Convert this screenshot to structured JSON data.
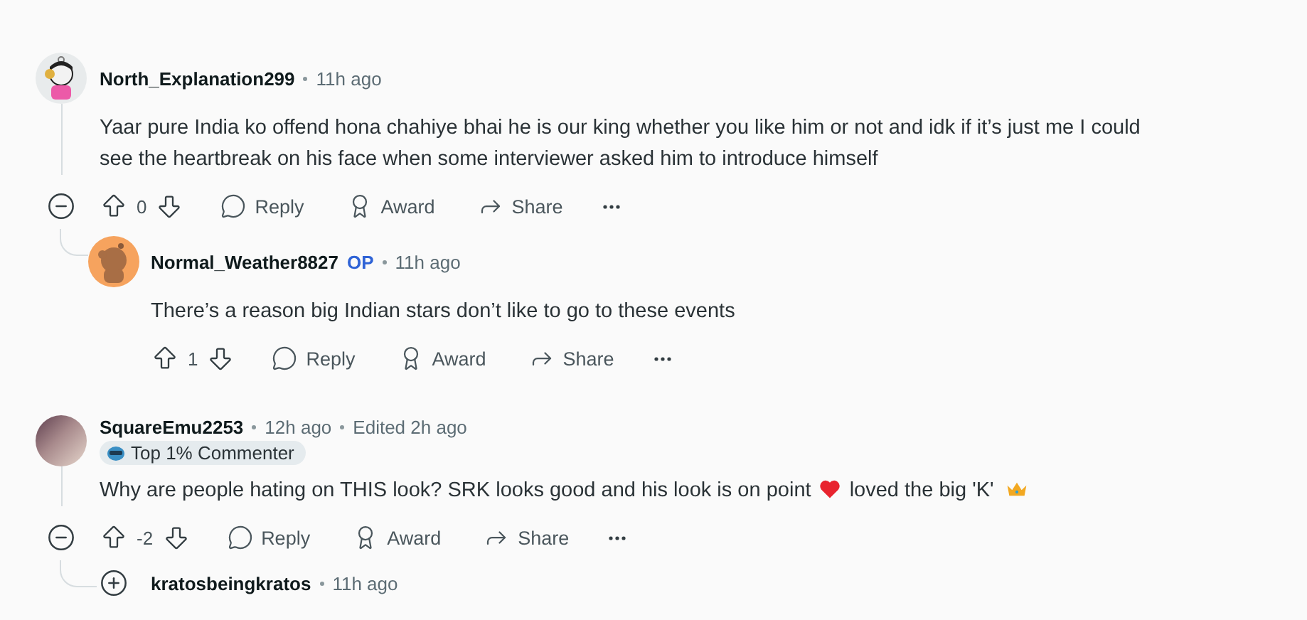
{
  "comments": [
    {
      "author": "North_Explanation299",
      "avatar": {
        "kind": "cartoon"
      },
      "time": "11h ago",
      "collapsed": false,
      "body": [
        {
          "kind": "text",
          "text": "Yaar pure India ko offend hona chahiye bhai he is our king whether you like him or not and idk if it’s just me I could see the heartbreak on his face when some interviewer asked him to introduce himself"
        }
      ],
      "score": "0",
      "actions": [
        "Reply",
        "Award",
        "Share"
      ],
      "replies": [
        {
          "author": "Normal_Weather8827",
          "op": "OP",
          "avatar": {
            "kind": "snoo"
          },
          "time": "11h ago",
          "body": [
            {
              "kind": "text",
              "text": "There’s a reason big Indian stars don’t like to go to these events"
            }
          ],
          "score": "1",
          "actions": [
            "Reply",
            "Award",
            "Share"
          ]
        }
      ]
    },
    {
      "author": "SquareEmu2253",
      "avatar": {
        "kind": "photo"
      },
      "time": "12h ago",
      "edited": "Edited 2h ago",
      "badge": "Top 1% Commenter",
      "collapsed": false,
      "body": [
        {
          "kind": "text",
          "text": "Why are people hating on THIS look? SRK looks good and his look is on point"
        },
        {
          "kind": "heart"
        },
        {
          "kind": "text",
          "text": "loved the big 'K'"
        },
        {
          "kind": "crown"
        }
      ],
      "score": "-2",
      "actions": [
        "Reply",
        "Award",
        "Share"
      ],
      "replies": [
        {
          "author": "kratosbeingkratos",
          "time": "11h ago",
          "collapsed": true
        }
      ]
    }
  ]
}
